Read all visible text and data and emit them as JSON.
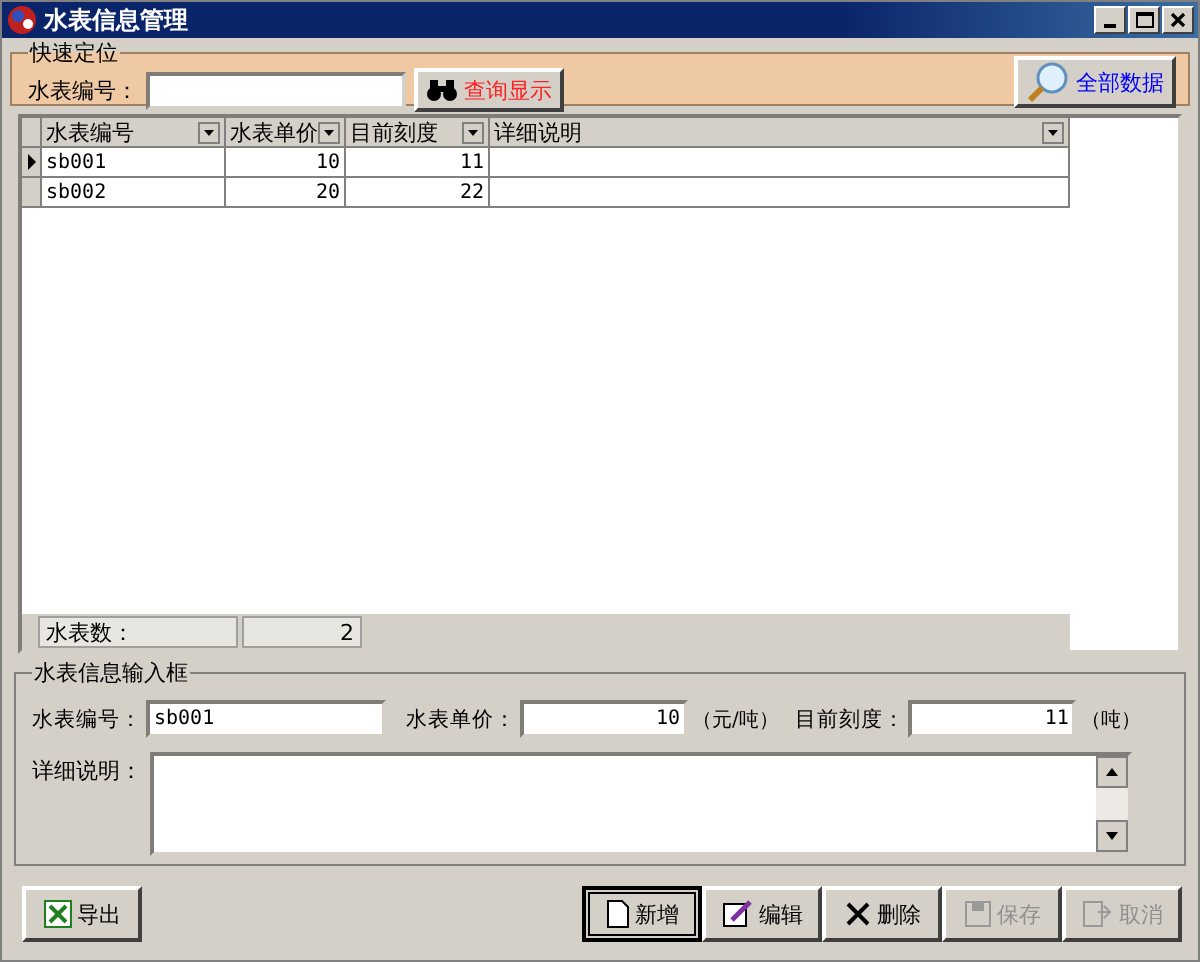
{
  "window": {
    "title": "水表信息管理"
  },
  "quick_search": {
    "legend": "快速定位",
    "label": "水表编号：",
    "find_button": "查询显示",
    "all_button": "全部数据"
  },
  "grid": {
    "columns": [
      {
        "label": "水表编号",
        "kind": "text"
      },
      {
        "label": "水表单价",
        "kind": "number"
      },
      {
        "label": "目前刻度",
        "kind": "number"
      },
      {
        "label": "详细说明",
        "kind": "text"
      }
    ],
    "rows": [
      {
        "selected": true,
        "cells": [
          "sb001",
          "10",
          "11",
          ""
        ]
      },
      {
        "selected": false,
        "cells": [
          "sb002",
          "20",
          "22",
          ""
        ]
      }
    ],
    "footer": {
      "label": "水表数：",
      "value": "2"
    }
  },
  "input_group": {
    "legend": "水表信息输入框",
    "fields": [
      {
        "label": "水表编号：",
        "value": "sb001",
        "kind": "text"
      },
      {
        "label": "水表单价：",
        "value": "10",
        "unit": "（元/吨）",
        "kind": "number"
      },
      {
        "label": "目前刻度：",
        "value": "11",
        "unit": "（吨）",
        "kind": "number"
      }
    ],
    "detail_label": "详细说明："
  },
  "export_button": "导出",
  "actions": [
    {
      "kind": "new",
      "label": "新增",
      "disabled": false,
      "default": true
    },
    {
      "kind": "edit",
      "label": "编辑",
      "disabled": false,
      "default": false
    },
    {
      "kind": "delete",
      "label": "删除",
      "disabled": false,
      "default": false
    },
    {
      "kind": "save",
      "label": "保存",
      "disabled": true,
      "default": false
    },
    {
      "kind": "cancel",
      "label": "取消",
      "disabled": true,
      "default": false
    }
  ]
}
